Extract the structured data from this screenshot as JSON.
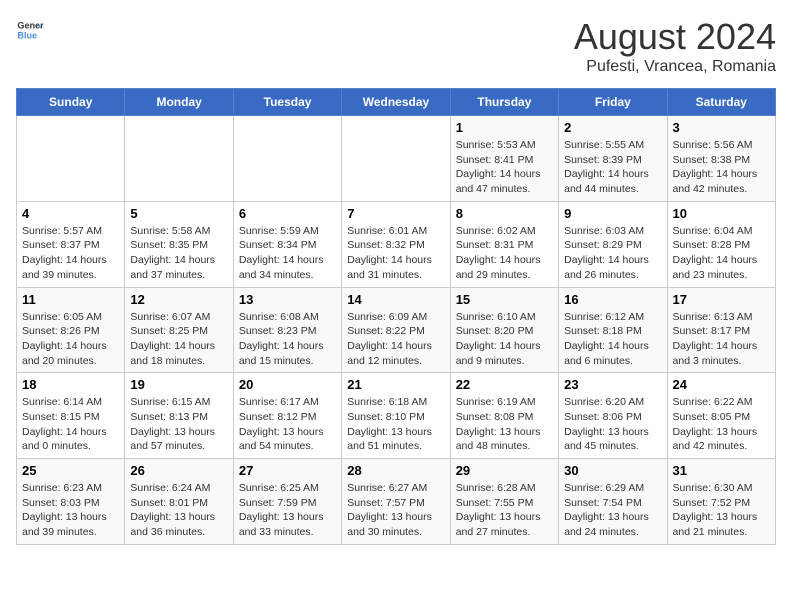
{
  "header": {
    "logo_line1": "General",
    "logo_line2": "Blue",
    "main_title": "August 2024",
    "subtitle": "Pufesti, Vrancea, Romania"
  },
  "days_of_week": [
    "Sunday",
    "Monday",
    "Tuesday",
    "Wednesday",
    "Thursday",
    "Friday",
    "Saturday"
  ],
  "weeks": [
    {
      "cells": [
        {
          "day": "",
          "info": ""
        },
        {
          "day": "",
          "info": ""
        },
        {
          "day": "",
          "info": ""
        },
        {
          "day": "",
          "info": ""
        },
        {
          "day": "1",
          "info": "Sunrise: 5:53 AM\nSunset: 8:41 PM\nDaylight: 14 hours and 47 minutes."
        },
        {
          "day": "2",
          "info": "Sunrise: 5:55 AM\nSunset: 8:39 PM\nDaylight: 14 hours and 44 minutes."
        },
        {
          "day": "3",
          "info": "Sunrise: 5:56 AM\nSunset: 8:38 PM\nDaylight: 14 hours and 42 minutes."
        }
      ]
    },
    {
      "cells": [
        {
          "day": "4",
          "info": "Sunrise: 5:57 AM\nSunset: 8:37 PM\nDaylight: 14 hours and 39 minutes."
        },
        {
          "day": "5",
          "info": "Sunrise: 5:58 AM\nSunset: 8:35 PM\nDaylight: 14 hours and 37 minutes."
        },
        {
          "day": "6",
          "info": "Sunrise: 5:59 AM\nSunset: 8:34 PM\nDaylight: 14 hours and 34 minutes."
        },
        {
          "day": "7",
          "info": "Sunrise: 6:01 AM\nSunset: 8:32 PM\nDaylight: 14 hours and 31 minutes."
        },
        {
          "day": "8",
          "info": "Sunrise: 6:02 AM\nSunset: 8:31 PM\nDaylight: 14 hours and 29 minutes."
        },
        {
          "day": "9",
          "info": "Sunrise: 6:03 AM\nSunset: 8:29 PM\nDaylight: 14 hours and 26 minutes."
        },
        {
          "day": "10",
          "info": "Sunrise: 6:04 AM\nSunset: 8:28 PM\nDaylight: 14 hours and 23 minutes."
        }
      ]
    },
    {
      "cells": [
        {
          "day": "11",
          "info": "Sunrise: 6:05 AM\nSunset: 8:26 PM\nDaylight: 14 hours and 20 minutes."
        },
        {
          "day": "12",
          "info": "Sunrise: 6:07 AM\nSunset: 8:25 PM\nDaylight: 14 hours and 18 minutes."
        },
        {
          "day": "13",
          "info": "Sunrise: 6:08 AM\nSunset: 8:23 PM\nDaylight: 14 hours and 15 minutes."
        },
        {
          "day": "14",
          "info": "Sunrise: 6:09 AM\nSunset: 8:22 PM\nDaylight: 14 hours and 12 minutes."
        },
        {
          "day": "15",
          "info": "Sunrise: 6:10 AM\nSunset: 8:20 PM\nDaylight: 14 hours and 9 minutes."
        },
        {
          "day": "16",
          "info": "Sunrise: 6:12 AM\nSunset: 8:18 PM\nDaylight: 14 hours and 6 minutes."
        },
        {
          "day": "17",
          "info": "Sunrise: 6:13 AM\nSunset: 8:17 PM\nDaylight: 14 hours and 3 minutes."
        }
      ]
    },
    {
      "cells": [
        {
          "day": "18",
          "info": "Sunrise: 6:14 AM\nSunset: 8:15 PM\nDaylight: 14 hours and 0 minutes."
        },
        {
          "day": "19",
          "info": "Sunrise: 6:15 AM\nSunset: 8:13 PM\nDaylight: 13 hours and 57 minutes."
        },
        {
          "day": "20",
          "info": "Sunrise: 6:17 AM\nSunset: 8:12 PM\nDaylight: 13 hours and 54 minutes."
        },
        {
          "day": "21",
          "info": "Sunrise: 6:18 AM\nSunset: 8:10 PM\nDaylight: 13 hours and 51 minutes."
        },
        {
          "day": "22",
          "info": "Sunrise: 6:19 AM\nSunset: 8:08 PM\nDaylight: 13 hours and 48 minutes."
        },
        {
          "day": "23",
          "info": "Sunrise: 6:20 AM\nSunset: 8:06 PM\nDaylight: 13 hours and 45 minutes."
        },
        {
          "day": "24",
          "info": "Sunrise: 6:22 AM\nSunset: 8:05 PM\nDaylight: 13 hours and 42 minutes."
        }
      ]
    },
    {
      "cells": [
        {
          "day": "25",
          "info": "Sunrise: 6:23 AM\nSunset: 8:03 PM\nDaylight: 13 hours and 39 minutes."
        },
        {
          "day": "26",
          "info": "Sunrise: 6:24 AM\nSunset: 8:01 PM\nDaylight: 13 hours and 36 minutes."
        },
        {
          "day": "27",
          "info": "Sunrise: 6:25 AM\nSunset: 7:59 PM\nDaylight: 13 hours and 33 minutes."
        },
        {
          "day": "28",
          "info": "Sunrise: 6:27 AM\nSunset: 7:57 PM\nDaylight: 13 hours and 30 minutes."
        },
        {
          "day": "29",
          "info": "Sunrise: 6:28 AM\nSunset: 7:55 PM\nDaylight: 13 hours and 27 minutes."
        },
        {
          "day": "30",
          "info": "Sunrise: 6:29 AM\nSunset: 7:54 PM\nDaylight: 13 hours and 24 minutes."
        },
        {
          "day": "31",
          "info": "Sunrise: 6:30 AM\nSunset: 7:52 PM\nDaylight: 13 hours and 21 minutes."
        }
      ]
    }
  ]
}
